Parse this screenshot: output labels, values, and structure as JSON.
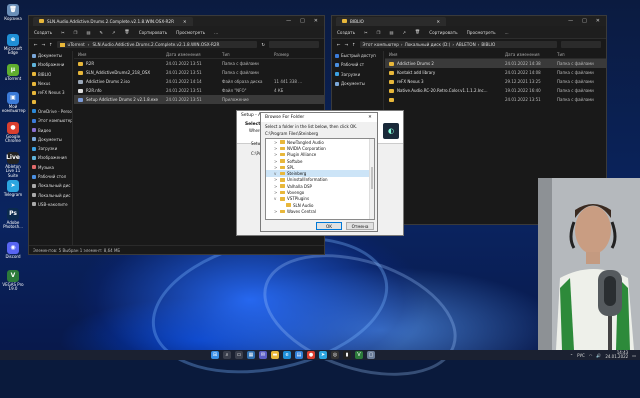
{
  "desktop": {
    "icons": [
      {
        "label": "Корзина",
        "color": "#6a8fb8",
        "glyph": "🗑"
      },
      {
        "label": "Microsoft Edge",
        "color": "#1f8fd6",
        "glyph": "e"
      },
      {
        "label": "uTorrent",
        "color": "#5fae2e",
        "glyph": "µ"
      },
      {
        "label": "Мой компьютер",
        "color": "#3b7bd9",
        "glyph": "▣"
      },
      {
        "label": "Google Chrome",
        "color": "#d93f2f",
        "glyph": "●"
      },
      {
        "label": "Ableton Live 11 Suite",
        "color": "#222222",
        "glyph": "Live"
      },
      {
        "label": "Telegram",
        "color": "#2ca5e0",
        "glyph": "➤"
      },
      {
        "label": "Adobe Photosh...",
        "color": "#0b2a4d",
        "glyph": "Ps"
      },
      {
        "label": "Discord",
        "color": "#5865f2",
        "glyph": "◉"
      },
      {
        "label": "VEGAS Pro 19.0",
        "color": "#2c7a3a",
        "glyph": "V"
      }
    ]
  },
  "left_window": {
    "tab_title": "SLN.Audio.Addictive.Drums.2.Complete.v2.1.8.WIN.OSX-R2R",
    "controls": [
      "—",
      "□",
      "✕"
    ],
    "toolbar": [
      "Создать",
      "Сортировать",
      "Просмотреть",
      "..."
    ],
    "address": [
      "uTorrent",
      "SLN.Audio.Addictive.Drums.2.Complete.v2.1.8.WIN.OSX-R2R"
    ],
    "nav": [
      {
        "label": "Документы",
        "color": "#7aa7d8"
      },
      {
        "label": "Изображени",
        "color": "#5fb3d9"
      },
      {
        "label": "BIBLIO",
        "color": "#e8b73a"
      },
      {
        "label": "Nexus",
        "color": "#e8b73a"
      },
      {
        "label": "reFX Nexus 3",
        "color": "#e8b73a"
      },
      {
        "label": "",
        "color": "#e8b73a"
      },
      {
        "label": "OneDrive - Perso",
        "color": "#2b88d8"
      },
      {
        "label": "Этот компьютер",
        "color": "#3b7bd9"
      },
      {
        "label": "Видео",
        "color": "#8a6fd1"
      },
      {
        "label": "Документы",
        "color": "#7aa7d8"
      },
      {
        "label": "Загрузки",
        "color": "#3ba0e0"
      },
      {
        "label": "Изображения",
        "color": "#5fb3d9"
      },
      {
        "label": "Музыка",
        "color": "#e06a6a"
      },
      {
        "label": "Рабочий стол",
        "color": "#4a8fe0"
      },
      {
        "label": "Локальный дис",
        "color": "#aaaaaa"
      },
      {
        "label": "Локальный дис",
        "color": "#aaaaaa"
      },
      {
        "label": "USB-накопите",
        "color": "#aaaaaa"
      }
    ],
    "headers": [
      "Имя",
      "Дата изменения",
      "Тип",
      "Размер"
    ],
    "files": [
      {
        "name": "R2R",
        "date": "24.01.2022 13:51",
        "type": "Папка с файлами",
        "size": "",
        "color": "#e8b73a"
      },
      {
        "name": "SLN_AddictiveDrums2_218_OSX",
        "date": "24.01.2022 13:51",
        "type": "Папка с файлами",
        "size": "",
        "color": "#e8b73a"
      },
      {
        "name": "Addictive Drums 2.iso",
        "date": "24.01.2022 14:14",
        "type": "Файл образа диска",
        "size": "11 441 338 ...",
        "color": "#9aa7b8"
      },
      {
        "name": "R2R.nfo",
        "date": "24.01.2022 13:51",
        "type": "Файл \"NFO\"",
        "size": "4 КБ",
        "color": "#dddddd"
      },
      {
        "name": "Setup Addictive Drums 2 v2.1.8.exe",
        "date": "24.01.2022 13:51",
        "type": "Приложение",
        "size": "",
        "color": "#7a9ad8",
        "selected": true
      }
    ],
    "status": "Элементов: 5   Выбран 1 элемент: 8,64 МБ"
  },
  "right_window": {
    "tab_title": "BIBLIO",
    "controls": [
      "—",
      "□",
      "✕"
    ],
    "toolbar": [
      "Создать",
      "Сортировать",
      "Просмотреть",
      "..."
    ],
    "address": [
      "Этот компьютер",
      "Локальный диск (D:)",
      "ABLETON",
      "BIBLIO"
    ],
    "nav": [
      {
        "label": "Быстрый доступ",
        "color": "#3b7bd9"
      },
      {
        "label": "Рабочий ст",
        "color": "#4a8fe0"
      },
      {
        "label": "Загрузки",
        "color": "#3ba0e0"
      },
      {
        "label": "Документы",
        "color": "#7aa7d8"
      }
    ],
    "headers": [
      "Имя",
      "Дата изменения",
      "Тип"
    ],
    "files": [
      {
        "name": "Addictive Drums 2",
        "date": "24.01.2022 14:38",
        "type": "Папка с файлами",
        "color": "#e8b73a",
        "selected": true
      },
      {
        "name": "Kontakt add library",
        "date": "24.01.2022 14:08",
        "type": "Папка с файлами",
        "color": "#e8b73a"
      },
      {
        "name": "reFX Nexus 3",
        "date": "29.12.2021 13:25",
        "type": "Папка с файлами",
        "color": "#e8b73a"
      },
      {
        "name": "Native.Audio.RC-20.Retro.Color.v1.1.1.2.Inc...",
        "date": "19.01.2022 16:40",
        "type": "Папка с файлами",
        "color": "#e8b73a"
      },
      {
        "name": "",
        "date": "24.01.2022 13:51",
        "type": "Папка с файлами",
        "color": "#e8b73a"
      }
    ]
  },
  "installer": {
    "title": "Setup - Addictive Drums",
    "heading": "Select Destination Location",
    "subheading": "Where should",
    "body1": "Setup",
    "body2": "C:\\Prog",
    "side1": "Setup",
    "side2": "C:\\Prog",
    "side3": "At le"
  },
  "browse": {
    "title": "Browse For Folder",
    "instruction": "Select a folder in the list below, then click OK.",
    "path": "C:\\Program Files\\Steinberg",
    "tree": [
      {
        "label": "NewTangled Audio",
        "indent": 1,
        "arrow": ">"
      },
      {
        "label": "NVIDIA Corporation",
        "indent": 1,
        "arrow": ">"
      },
      {
        "label": "Plugin Alliance",
        "indent": 1,
        "arrow": ">"
      },
      {
        "label": "Softube",
        "indent": 1,
        "arrow": ">"
      },
      {
        "label": "SPL",
        "indent": 1,
        "arrow": ">"
      },
      {
        "label": "Steinberg",
        "indent": 1,
        "arrow": "v",
        "selected": true
      },
      {
        "label": "UninstallInformation",
        "indent": 1,
        "arrow": ">"
      },
      {
        "label": "Valhalla DSP",
        "indent": 1,
        "arrow": ">"
      },
      {
        "label": "Vovengo",
        "indent": 1,
        "arrow": ">"
      },
      {
        "label": "VSTPlugins",
        "indent": 1,
        "arrow": "v"
      },
      {
        "label": "SLN Audio",
        "indent": 2,
        "arrow": ""
      },
      {
        "label": "Waves Central",
        "indent": 1,
        "arrow": ">"
      }
    ],
    "ok": "OK",
    "cancel": "Отмена"
  },
  "taskbar": {
    "apps": [
      {
        "name": "start",
        "color": "#3a8ee6",
        "glyph": "⊞"
      },
      {
        "name": "search",
        "color": "#3a3f4d",
        "glyph": "⌕"
      },
      {
        "name": "task-view",
        "color": "#3a3f4d",
        "glyph": "▭"
      },
      {
        "name": "widgets",
        "color": "#2f6fb0",
        "glyph": "▦"
      },
      {
        "name": "chat",
        "color": "#5b5fc7",
        "glyph": "✉"
      },
      {
        "name": "explorer",
        "color": "#e8b73a",
        "glyph": "▬"
      },
      {
        "name": "edge",
        "color": "#1f8fd6",
        "glyph": "e"
      },
      {
        "name": "store",
        "color": "#2f7fd6",
        "glyph": "▤"
      },
      {
        "name": "chrome",
        "color": "#d93f2f",
        "glyph": "●"
      },
      {
        "name": "telegram",
        "color": "#2ca5e0",
        "glyph": "➤"
      },
      {
        "name": "obs",
        "color": "#333333",
        "glyph": "◎"
      },
      {
        "name": "ableton",
        "color": "#222222",
        "glyph": "▮"
      },
      {
        "name": "vegas",
        "color": "#2c7a3a",
        "glyph": "V"
      },
      {
        "name": "setup",
        "color": "#6b7d99",
        "glyph": "▢"
      }
    ],
    "lang": "РУС",
    "time": "14:43",
    "date": "24.01.2022"
  }
}
